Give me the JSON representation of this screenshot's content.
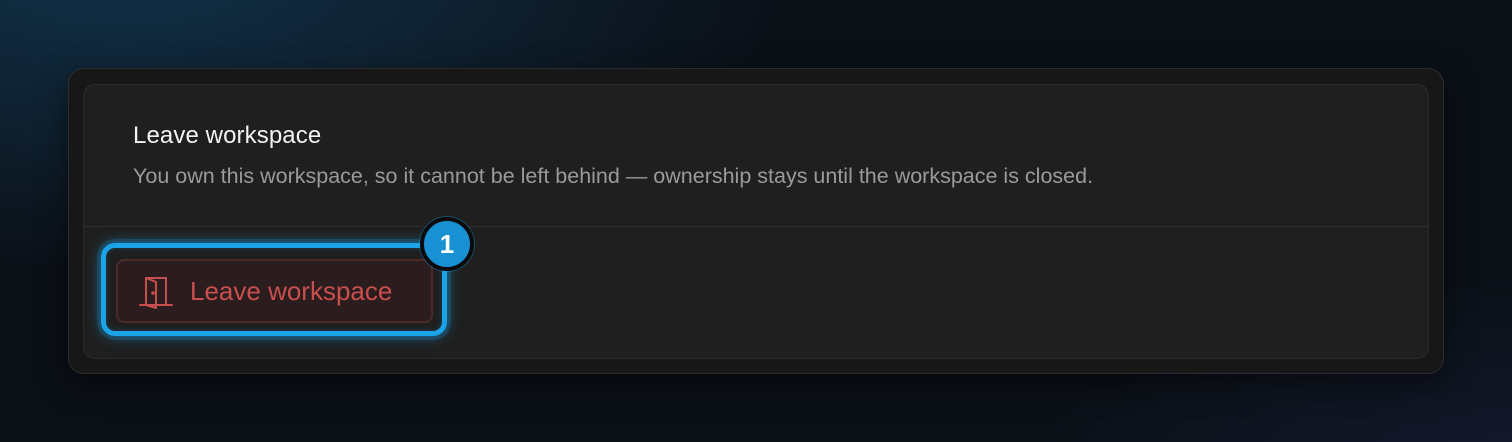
{
  "section": {
    "title": "Leave workspace",
    "description": "You own this workspace, so it cannot be left behind — ownership stays until the workspace is closed."
  },
  "leave_button": {
    "label": "Leave workspace",
    "icon": "door-icon",
    "text_color": "#c94f4f"
  },
  "annotation": {
    "step_number": "1",
    "highlight_color": "#1ba3e8"
  }
}
